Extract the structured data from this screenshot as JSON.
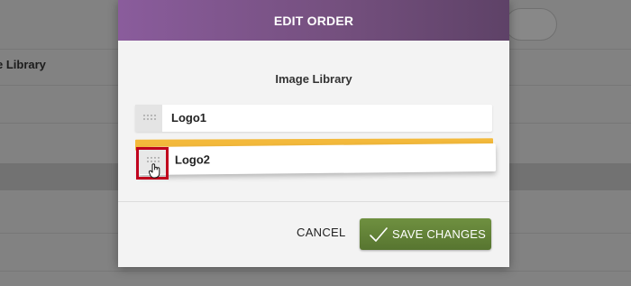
{
  "background": {
    "section_label": "e Library"
  },
  "modal": {
    "title": "EDIT ORDER",
    "section_title": "Image Library",
    "items": [
      {
        "label": "Logo1"
      },
      {
        "label": "Logo2"
      }
    ],
    "cancel_label": "CANCEL",
    "save_label": "SAVE CHANGES"
  },
  "colors": {
    "header_start": "#8a5c9c",
    "header_end": "#5e4267",
    "placeholder": "#f3b93b",
    "save_button": "#648436",
    "highlight": "#c0001d"
  },
  "icons": {
    "drag_handle": "grip-dots-icon",
    "cursor": "hand-cursor-icon",
    "save": "check-icon"
  }
}
